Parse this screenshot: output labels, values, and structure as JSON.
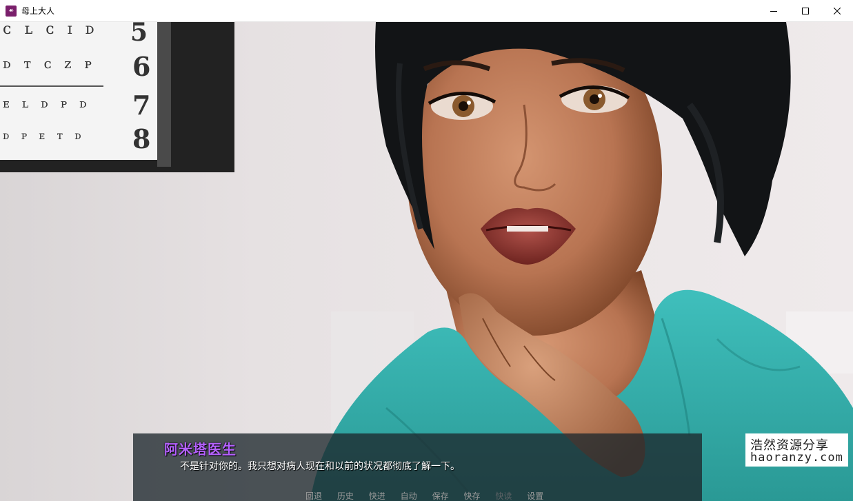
{
  "window": {
    "title": "母上大人",
    "icon": "app-icon",
    "controls": [
      "minimize-icon",
      "maximize-icon",
      "close-icon"
    ]
  },
  "scene": {
    "eye_chart": {
      "rows": [
        {
          "letters": "ᴄ ʟ ᴄ ɪ ᴅ",
          "number": "5"
        },
        {
          "letters": "ᴅ ᴛ ᴄ ᴢ ᴘ",
          "number": "6"
        },
        {
          "letters": "ᴇ ʟ ᴅ ᴘ ᴅ",
          "number": "7"
        },
        {
          "letters": "ᴅ ᴘ ᴇ ᴛ ᴅ",
          "number": "8"
        }
      ]
    }
  },
  "dialogue": {
    "speaker": "阿米塔医生",
    "text": "不是针对你的。我只想对病人现在和以前的状况都彻底了解一下。",
    "speaker_color": "#b561ff"
  },
  "quick_menu": [
    {
      "label": "回退",
      "enabled": true
    },
    {
      "label": "历史",
      "enabled": true
    },
    {
      "label": "快进",
      "enabled": true
    },
    {
      "label": "自动",
      "enabled": true
    },
    {
      "label": "保存",
      "enabled": true
    },
    {
      "label": "快存",
      "enabled": true
    },
    {
      "label": "快读",
      "enabled": false
    },
    {
      "label": "设置",
      "enabled": true
    }
  ],
  "watermark": {
    "cn": "浩然资源分享",
    "en": "haoranzy.com"
  }
}
